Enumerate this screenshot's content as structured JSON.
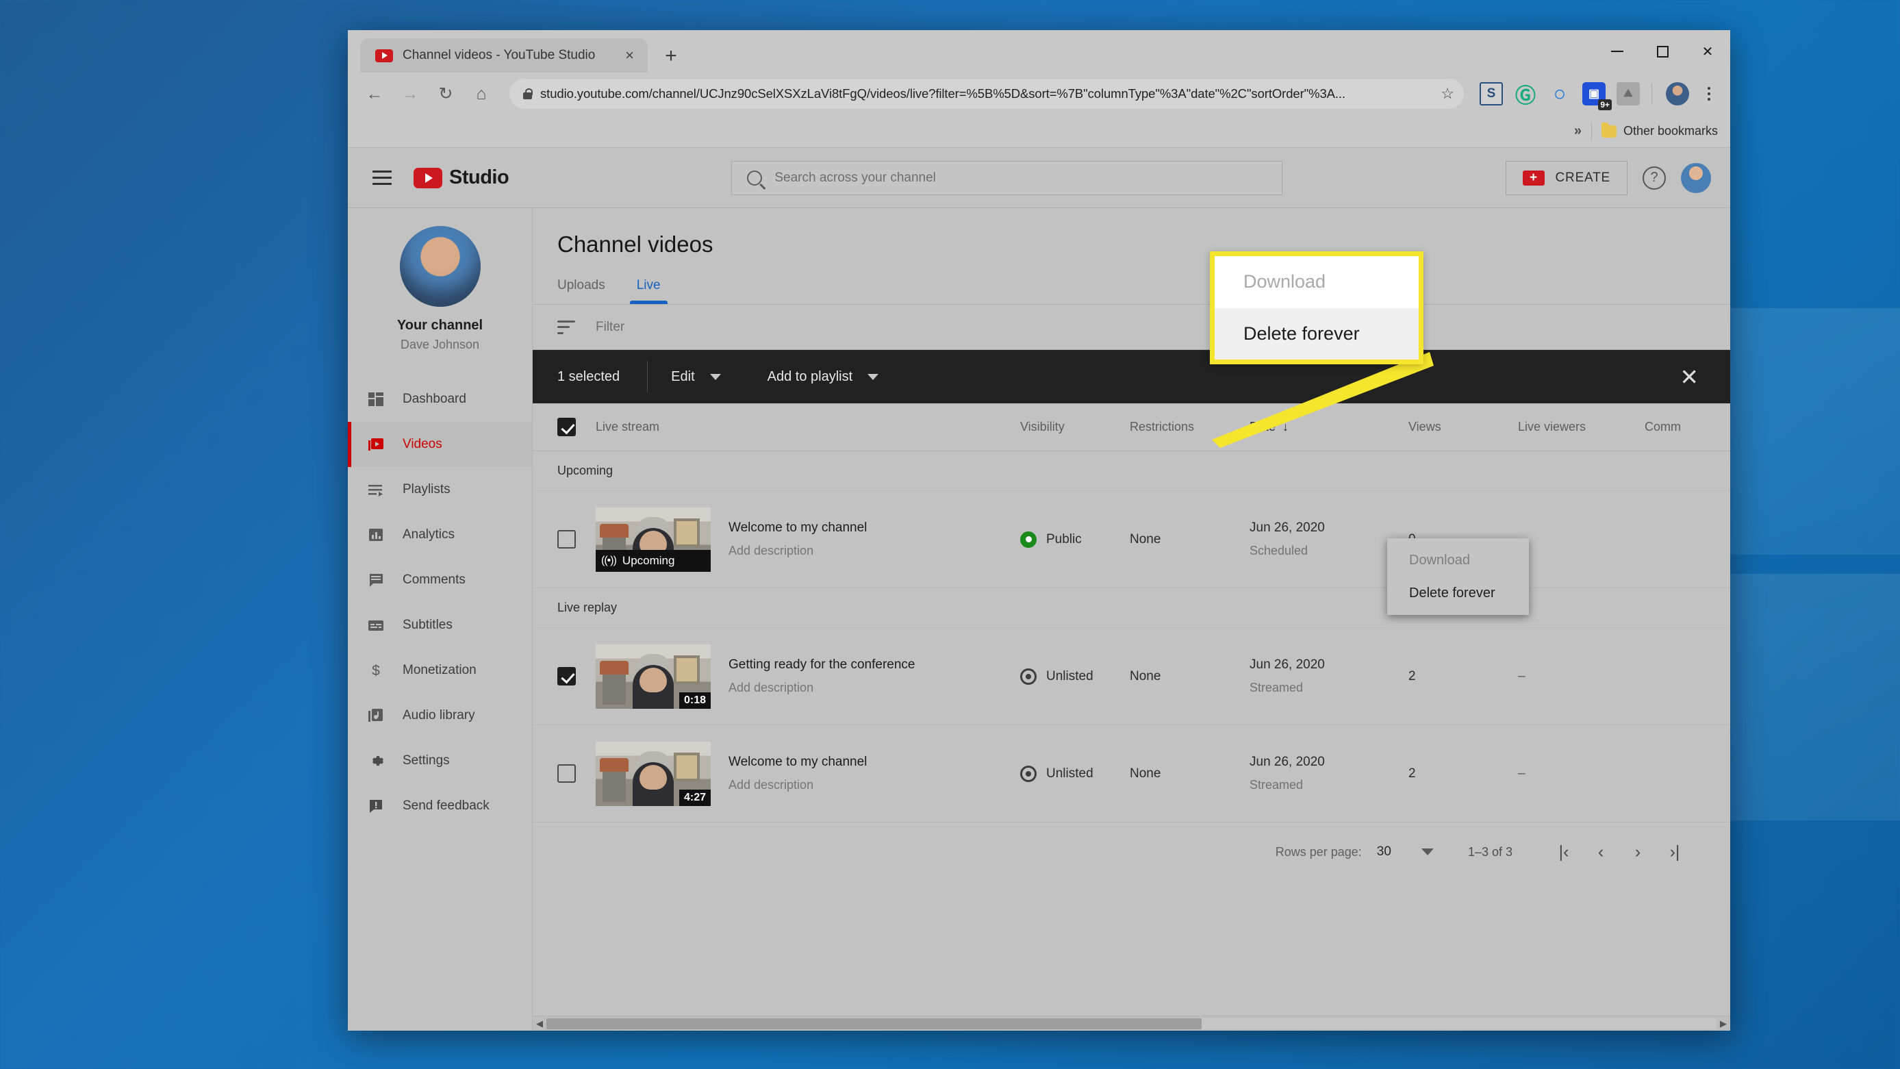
{
  "browser": {
    "tab": {
      "title": "Channel videos - YouTube Studio",
      "close": "×",
      "favicon": "youtube-favicon"
    },
    "newtab": "+",
    "window_controls": {
      "minimize": "—",
      "maximize": "□",
      "close": "✕"
    },
    "nav": {
      "back": "←",
      "forward": "→",
      "reload": "↻",
      "home": "⌂"
    },
    "url": "studio.youtube.com/channel/UCJnz90cSelXSXzLaVi8tFgQ/videos/live?filter=%5B%5D&sort=%7B\"columnType\"%3A\"date\"%2C\"sortOrder\"%3A...",
    "url_domain": "studio.youtube.com",
    "url_path": "/channel/UCJnz90cSelXSXzLaVi8tFgQ/videos/live?filter=%5B%5D&sort=%7B\"columnType\"%3A\"date\"%2C\"sortOrder\"%3A...",
    "star": "☆",
    "extensions": [
      {
        "name": "extension-s-icon",
        "glyph": "S"
      },
      {
        "name": "grammarly-icon",
        "glyph": "Ⓖ"
      },
      {
        "name": "extension-o-icon",
        "glyph": "○"
      },
      {
        "name": "extension-badge-icon",
        "glyph": "▣",
        "badge": "9+"
      },
      {
        "name": "extension-gray-icon",
        "glyph": "⛰"
      }
    ],
    "bookmarks": {
      "overflow": "»",
      "other_label": "Other bookmarks"
    }
  },
  "studio": {
    "header": {
      "brand": "Studio",
      "search_placeholder": "Search across your channel",
      "create_label": "CREATE",
      "help": "?"
    },
    "sidebar": {
      "channel_label": "Your channel",
      "channel_name": "Dave Johnson",
      "items": [
        {
          "label": "Dashboard",
          "icon": "dashboard-icon",
          "active": false
        },
        {
          "label": "Videos",
          "icon": "videos-icon",
          "active": true
        },
        {
          "label": "Playlists",
          "icon": "playlists-icon",
          "active": false
        },
        {
          "label": "Analytics",
          "icon": "analytics-icon",
          "active": false
        },
        {
          "label": "Comments",
          "icon": "comments-icon",
          "active": false
        },
        {
          "label": "Subtitles",
          "icon": "subtitles-icon",
          "active": false
        },
        {
          "label": "Monetization",
          "icon": "monetization-icon",
          "active": false
        },
        {
          "label": "Audio library",
          "icon": "audio-library-icon",
          "active": false
        }
      ],
      "bottom_items": [
        {
          "label": "Settings",
          "icon": "gear-icon"
        },
        {
          "label": "Send feedback",
          "icon": "feedback-icon"
        }
      ]
    },
    "page_title": "Channel videos",
    "tabs": [
      {
        "label": "Uploads",
        "active": false
      },
      {
        "label": "Live",
        "active": true
      }
    ],
    "filter_placeholder": "Filter",
    "actionbar": {
      "selected_label": "1 selected",
      "edit_label": "Edit",
      "playlist_label": "Add to playlist",
      "close": "✕"
    },
    "menu": {
      "items": [
        {
          "label": "Download",
          "disabled": true
        },
        {
          "label": "Delete forever",
          "disabled": false
        }
      ]
    },
    "callout": {
      "items": [
        {
          "label": "Download",
          "state": "disabled"
        },
        {
          "label": "Delete forever",
          "state": "active"
        }
      ],
      "border_color": "#f5e52c"
    },
    "table": {
      "headers": {
        "stream": "Live stream",
        "visibility": "Visibility",
        "restrictions": "Restrictions",
        "date": "Date",
        "date_sort": "↓",
        "views": "Views",
        "live_viewers": "Live viewers",
        "comments": "Comm"
      },
      "groups": [
        {
          "name": "Upcoming",
          "rows": [
            {
              "checked": false,
              "title": "Welcome to my channel",
              "description": "Add description",
              "thumb_badge": "Upcoming",
              "thumb_badge_type": "live",
              "visibility": "Public",
              "visibility_type": "public",
              "restrictions": "None",
              "date": "Jun 26, 2020",
              "date_sub": "Scheduled",
              "views": "0",
              "live_viewers": "–"
            }
          ]
        },
        {
          "name": "Live replay",
          "rows": [
            {
              "checked": true,
              "title": "Getting ready for the conference",
              "description": "Add description",
              "thumb_badge": "0:18",
              "thumb_badge_type": "duration",
              "visibility": "Unlisted",
              "visibility_type": "unlisted",
              "restrictions": "None",
              "date": "Jun 26, 2020",
              "date_sub": "Streamed",
              "views": "2",
              "live_viewers": "–"
            },
            {
              "checked": false,
              "title": "Welcome to my channel",
              "description": "Add description",
              "thumb_badge": "4:27",
              "thumb_badge_type": "duration",
              "visibility": "Unlisted",
              "visibility_type": "unlisted",
              "restrictions": "None",
              "date": "Jun 26, 2020",
              "date_sub": "Streamed",
              "views": "2",
              "live_viewers": "–"
            }
          ]
        }
      ]
    },
    "pager": {
      "rows_label": "Rows per page:",
      "rows_value": "30",
      "range": "1–3 of 3",
      "first": "|‹",
      "prev": "‹",
      "next": "›",
      "last": "›|"
    }
  },
  "colors": {
    "accent_red": "#cc181e",
    "tab_blue": "#1561c2",
    "callout_yellow": "#f5e52c",
    "public_green": "#1a8a1a",
    "actionbar_dark": "#212121"
  }
}
